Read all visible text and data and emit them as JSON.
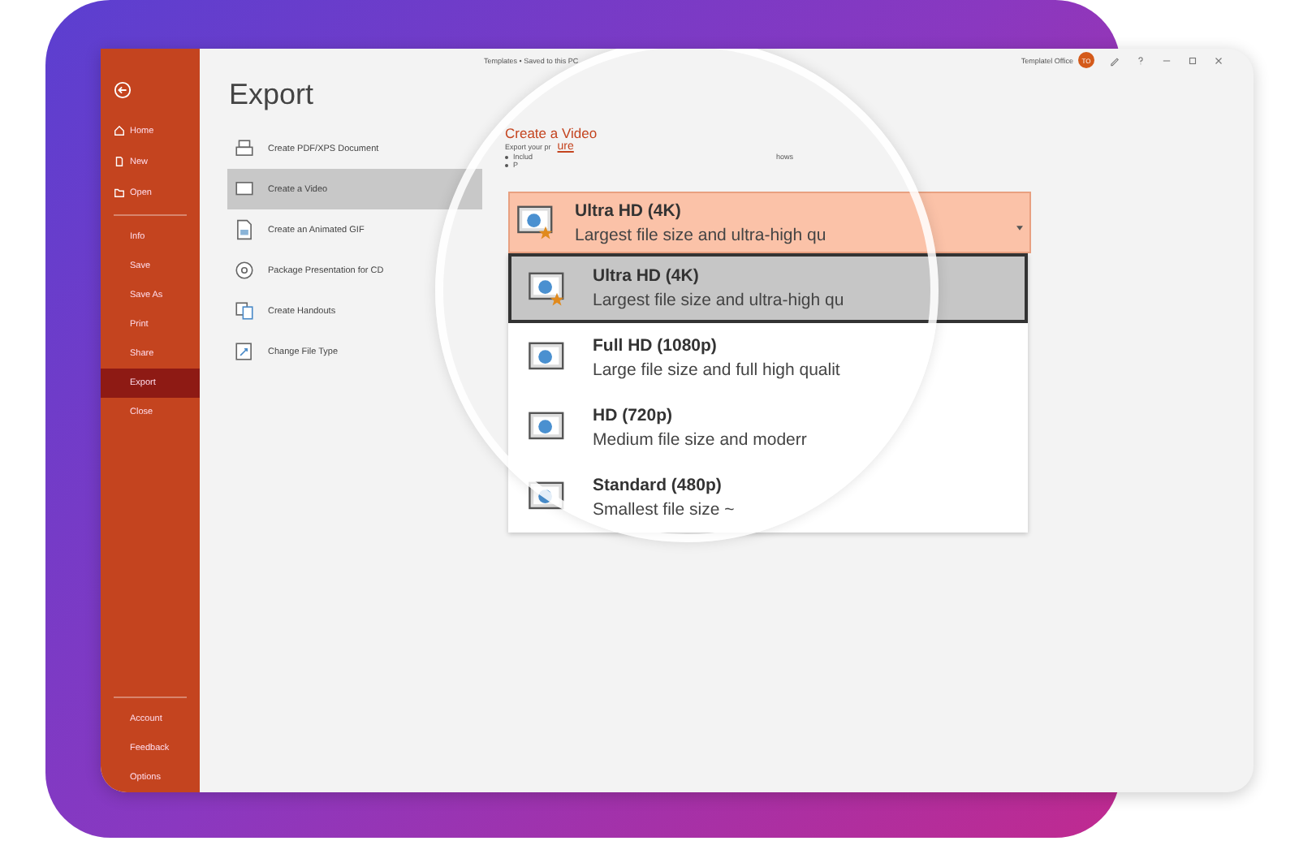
{
  "window": {
    "title": "Templates • Saved to this PC",
    "user": "Templatel Office",
    "avatar": "TO"
  },
  "sidebar": {
    "top_items": [
      {
        "label": "Home",
        "kind": "home",
        "selected": false
      },
      {
        "label": "New",
        "kind": "new",
        "selected": false
      },
      {
        "label": "Open",
        "kind": "open",
        "selected": false
      }
    ],
    "items": [
      {
        "label": "Info",
        "selected": false
      },
      {
        "label": "Save",
        "selected": false
      },
      {
        "label": "Save As",
        "selected": false
      },
      {
        "label": "Print",
        "selected": false
      },
      {
        "label": "Share",
        "selected": false
      },
      {
        "label": "Export",
        "selected": true
      },
      {
        "label": "Close",
        "selected": false
      }
    ],
    "bottom_items": [
      {
        "label": "Account"
      },
      {
        "label": "Feedback"
      },
      {
        "label": "Options"
      }
    ]
  },
  "page_title": "Export",
  "export_options": [
    {
      "label": "Create PDF/XPS Document",
      "kind": "pdf",
      "selected": false
    },
    {
      "label": "Create a Video",
      "kind": "video",
      "selected": true
    },
    {
      "label": "Create an Animated GIF",
      "kind": "gif",
      "selected": false
    },
    {
      "label": "Package Presentation for CD",
      "kind": "cd",
      "selected": false
    },
    {
      "label": "Create Handouts",
      "kind": "handouts",
      "selected": false
    },
    {
      "label": "Change File Type",
      "kind": "filetype",
      "selected": false
    }
  ],
  "detail": {
    "title": "Create a Video",
    "intro": "Export your pr",
    "link": "ure",
    "bullets": [
      "Includ",
      "P"
    ],
    "bullet_tail": "hows"
  },
  "quality_dropdown": {
    "value_title": "Ultra HD (4K)",
    "value_desc": "Largest file size and ultra-high qu",
    "options": [
      {
        "title": "Ultra HD (4K)",
        "desc": "Largest file size and ultra-high qu",
        "starred": true,
        "selected": true
      },
      {
        "title": "Full HD (1080p)",
        "desc": "Large file size and full high qualit",
        "starred": false,
        "selected": false
      },
      {
        "title": "HD (720p)",
        "desc": "Medium file size and moderr",
        "starred": false,
        "selected": false
      },
      {
        "title": "Standard (480p)",
        "desc": "Smallest file size ~",
        "starred": false,
        "selected": false
      }
    ]
  }
}
